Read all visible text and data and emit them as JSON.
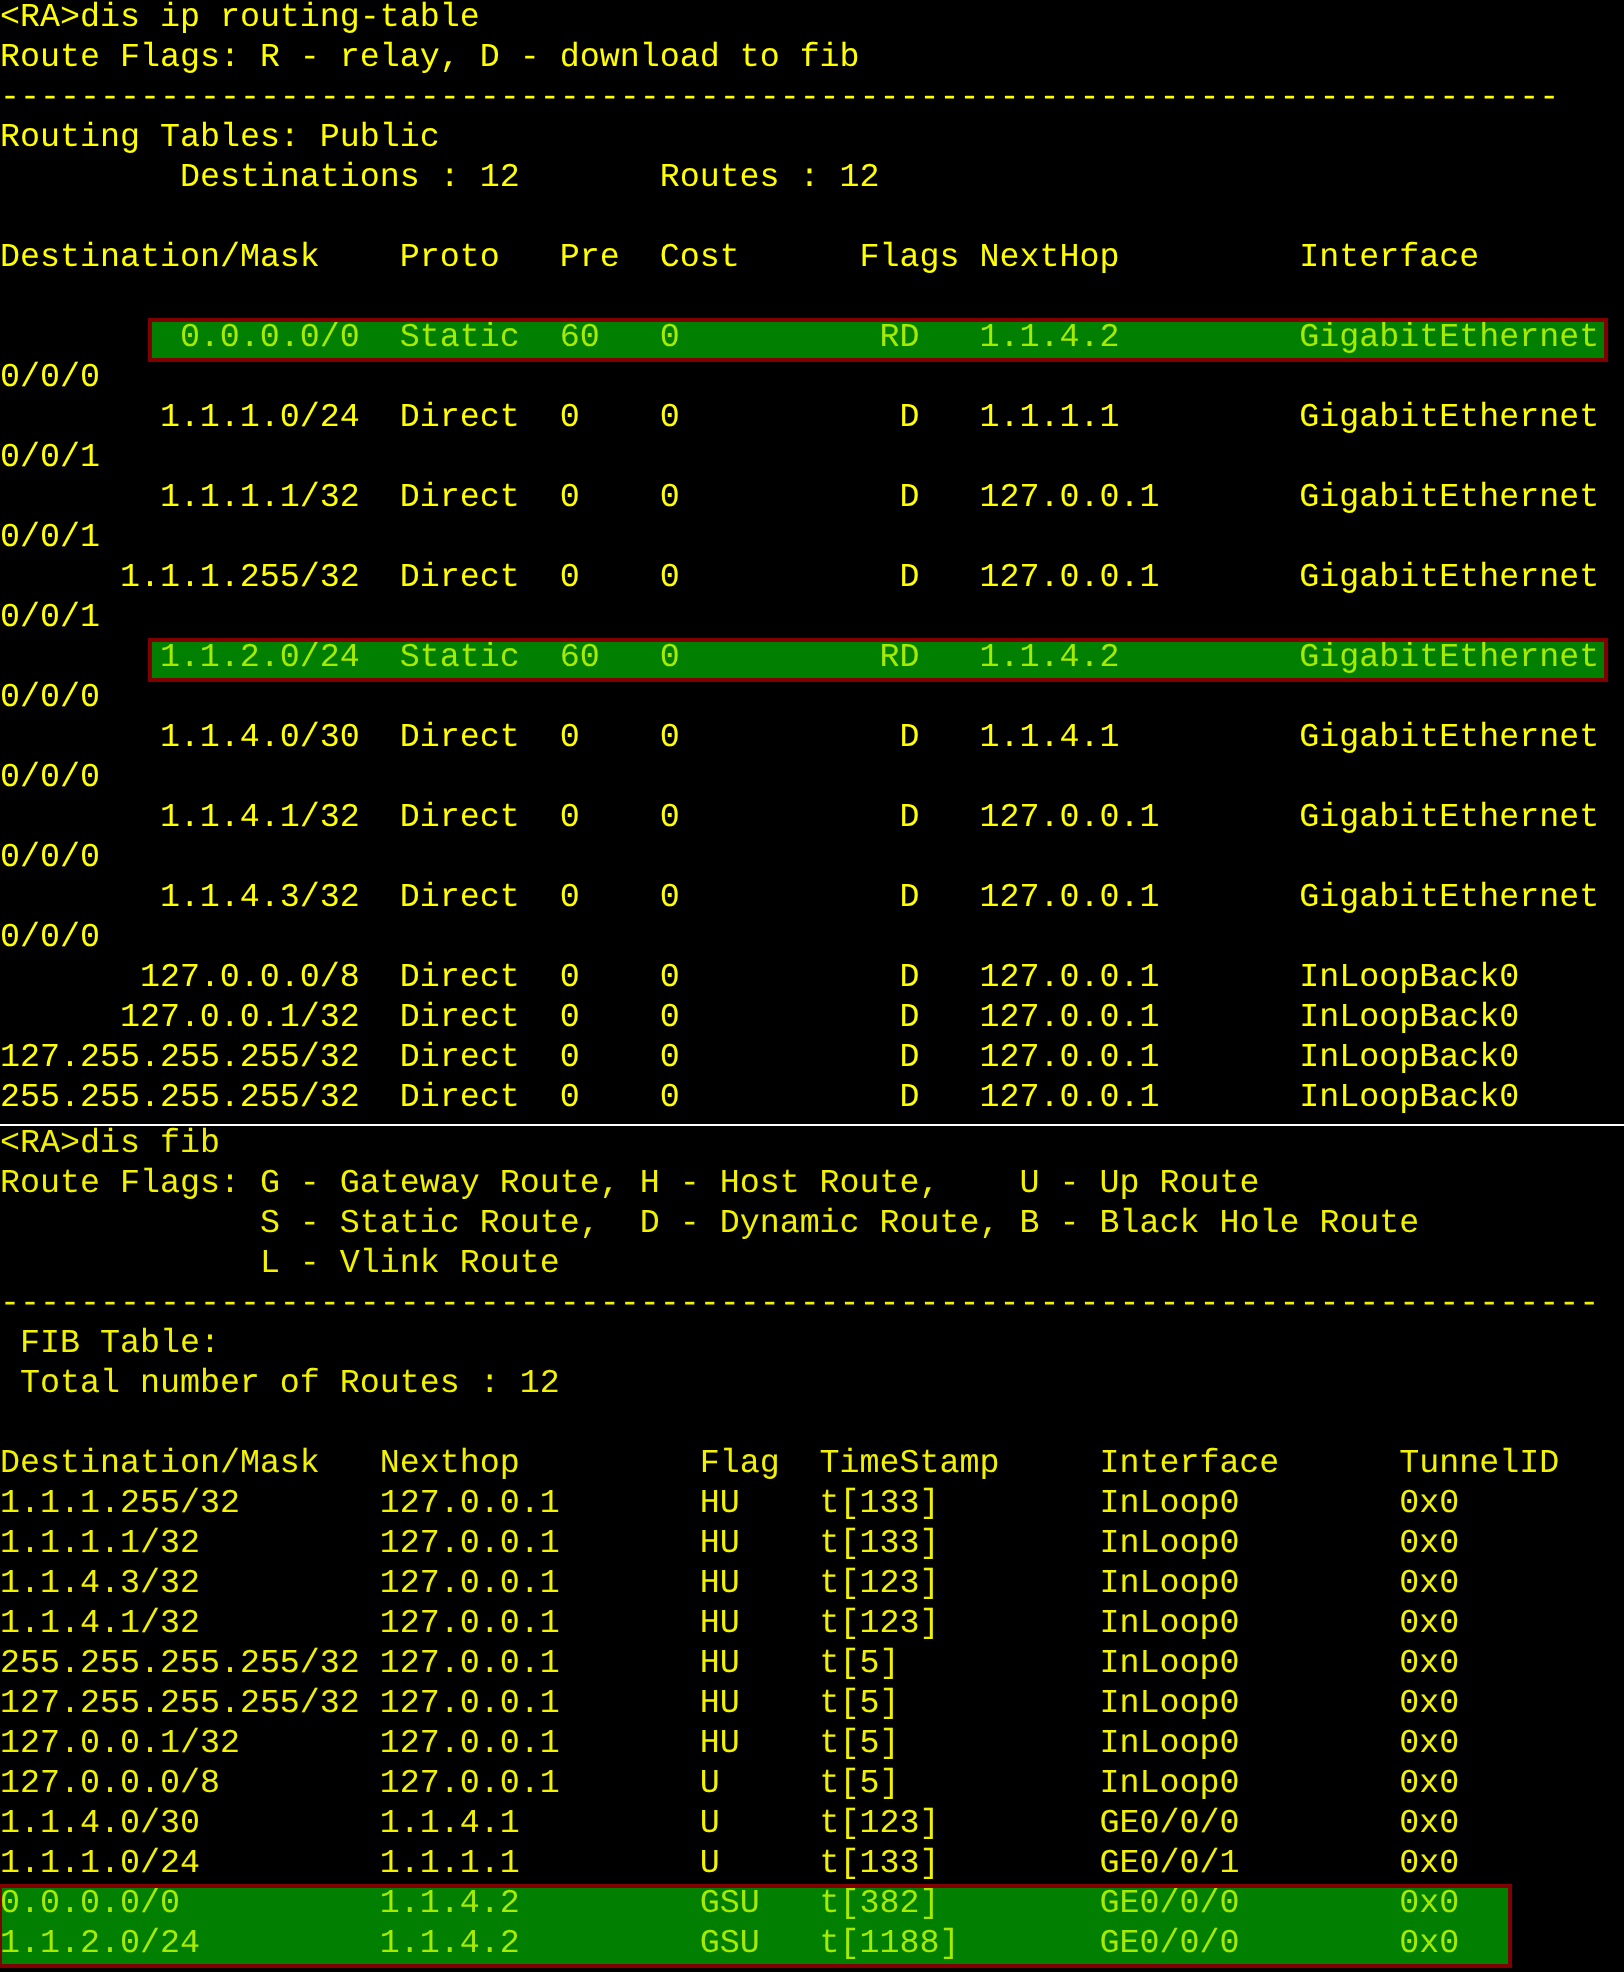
{
  "routing_table_screen": {
    "command": "<RA>dis ip routing-table",
    "flags_legend": "Route Flags: R - relay, D - download to fib",
    "divider": "------------------------------------------------------------------------------",
    "table_title": "Routing Tables: Public",
    "destinations": "Destinations : 12",
    "routes": "Routes : 12",
    "columns": [
      "Destination/Mask",
      "Proto",
      "Pre",
      "Cost",
      "Flags",
      "NextHop",
      "Interface"
    ],
    "rows": [
      {
        "destination": "0.0.0.0/0",
        "proto": "Static",
        "pre": "60",
        "cost": "0",
        "flags": "RD",
        "nexthop": "1.1.4.2",
        "interface": "GigabitEthernet",
        "interface_wrap": "0/0/0",
        "highlighted": true
      },
      {
        "destination": "1.1.1.0/24",
        "proto": "Direct",
        "pre": "0",
        "cost": "0",
        "flags": "D",
        "nexthop": "1.1.1.1",
        "interface": "GigabitEthernet",
        "interface_wrap": "0/0/1",
        "highlighted": false
      },
      {
        "destination": "1.1.1.1/32",
        "proto": "Direct",
        "pre": "0",
        "cost": "0",
        "flags": "D",
        "nexthop": "127.0.0.1",
        "interface": "GigabitEthernet",
        "interface_wrap": "0/0/1",
        "highlighted": false
      },
      {
        "destination": "1.1.1.255/32",
        "proto": "Direct",
        "pre": "0",
        "cost": "0",
        "flags": "D",
        "nexthop": "127.0.0.1",
        "interface": "GigabitEthernet",
        "interface_wrap": "0/0/1",
        "highlighted": false
      },
      {
        "destination": "1.1.2.0/24",
        "proto": "Static",
        "pre": "60",
        "cost": "0",
        "flags": "RD",
        "nexthop": "1.1.4.2",
        "interface": "GigabitEthernet",
        "interface_wrap": "0/0/0",
        "highlighted": true
      },
      {
        "destination": "1.1.4.0/30",
        "proto": "Direct",
        "pre": "0",
        "cost": "0",
        "flags": "D",
        "nexthop": "1.1.4.1",
        "interface": "GigabitEthernet",
        "interface_wrap": "0/0/0",
        "highlighted": false
      },
      {
        "destination": "1.1.4.1/32",
        "proto": "Direct",
        "pre": "0",
        "cost": "0",
        "flags": "D",
        "nexthop": "127.0.0.1",
        "interface": "GigabitEthernet",
        "interface_wrap": "0/0/0",
        "highlighted": false
      },
      {
        "destination": "1.1.4.3/32",
        "proto": "Direct",
        "pre": "0",
        "cost": "0",
        "flags": "D",
        "nexthop": "127.0.0.1",
        "interface": "GigabitEthernet",
        "interface_wrap": "0/0/0",
        "highlighted": false
      },
      {
        "destination": "127.0.0.0/8",
        "proto": "Direct",
        "pre": "0",
        "cost": "0",
        "flags": "D",
        "nexthop": "127.0.0.1",
        "interface": "InLoopBack0",
        "highlighted": false
      },
      {
        "destination": "127.0.0.1/32",
        "proto": "Direct",
        "pre": "0",
        "cost": "0",
        "flags": "D",
        "nexthop": "127.0.0.1",
        "interface": "InLoopBack0",
        "highlighted": false
      },
      {
        "destination": "127.255.255.255/32",
        "proto": "Direct",
        "pre": "0",
        "cost": "0",
        "flags": "D",
        "nexthop": "127.0.0.1",
        "interface": "InLoopBack0",
        "highlighted": false
      },
      {
        "destination": "255.255.255.255/32",
        "proto": "Direct",
        "pre": "0",
        "cost": "0",
        "flags": "D",
        "nexthop": "127.0.0.1",
        "interface": "InLoopBack0",
        "highlighted": false
      }
    ]
  },
  "fib_screen": {
    "command": "<RA>dis fib",
    "flags_legend": [
      "Route Flags: G - Gateway Route, H - Host Route,    U - Up Route",
      "S - Static Route,  D - Dynamic Route, B - Black Hole Route",
      "L - Vlink Route"
    ],
    "divider": "--------------------------------------------------------------------------------",
    "table_title": "FIB Table:",
    "total": "Total number of Routes : 12",
    "columns": [
      "Destination/Mask",
      "Nexthop",
      "Flag",
      "TimeStamp",
      "Interface",
      "TunnelID"
    ],
    "rows": [
      {
        "destination": "1.1.1.255/32",
        "nexthop": "127.0.0.1",
        "flag": "HU",
        "timestamp": "t[133]",
        "interface": "InLoop0",
        "tunnel_id": "0x0",
        "highlighted": false
      },
      {
        "destination": "1.1.1.1/32",
        "nexthop": "127.0.0.1",
        "flag": "HU",
        "timestamp": "t[133]",
        "interface": "InLoop0",
        "tunnel_id": "0x0",
        "highlighted": false
      },
      {
        "destination": "1.1.4.3/32",
        "nexthop": "127.0.0.1",
        "flag": "HU",
        "timestamp": "t[123]",
        "interface": "InLoop0",
        "tunnel_id": "0x0",
        "highlighted": false
      },
      {
        "destination": "1.1.4.1/32",
        "nexthop": "127.0.0.1",
        "flag": "HU",
        "timestamp": "t[123]",
        "interface": "InLoop0",
        "tunnel_id": "0x0",
        "highlighted": false
      },
      {
        "destination": "255.255.255.255/32",
        "nexthop": "127.0.0.1",
        "flag": "HU",
        "timestamp": "t[5]",
        "interface": "InLoop0",
        "tunnel_id": "0x0",
        "highlighted": false
      },
      {
        "destination": "127.255.255.255/32",
        "nexthop": "127.0.0.1",
        "flag": "HU",
        "timestamp": "t[5]",
        "interface": "InLoop0",
        "tunnel_id": "0x0",
        "highlighted": false
      },
      {
        "destination": "127.0.0.1/32",
        "nexthop": "127.0.0.1",
        "flag": "HU",
        "timestamp": "t[5]",
        "interface": "InLoop0",
        "tunnel_id": "0x0",
        "highlighted": false
      },
      {
        "destination": "127.0.0.0/8",
        "nexthop": "127.0.0.1",
        "flag": "U",
        "timestamp": "t[5]",
        "interface": "InLoop0",
        "tunnel_id": "0x0",
        "highlighted": false
      },
      {
        "destination": "1.1.4.0/30",
        "nexthop": "1.1.4.1",
        "flag": "U",
        "timestamp": "t[123]",
        "interface": "GE0/0/0",
        "tunnel_id": "0x0",
        "highlighted": false
      },
      {
        "destination": "1.1.1.0/24",
        "nexthop": "1.1.1.1",
        "flag": "U",
        "timestamp": "t[133]",
        "interface": "GE0/0/1",
        "tunnel_id": "0x0",
        "highlighted": false
      },
      {
        "destination": "0.0.0.0/0",
        "nexthop": "1.1.4.2",
        "flag": "GSU",
        "timestamp": "t[382]",
        "interface": "GE0/0/0",
        "tunnel_id": "0x0",
        "highlighted": true
      },
      {
        "destination": "1.1.2.0/24",
        "nexthop": "1.1.4.2",
        "flag": "GSU",
        "timestamp": "t[1188]",
        "interface": "GE0/0/0",
        "tunnel_id": "0x0",
        "highlighted": true
      }
    ]
  }
}
